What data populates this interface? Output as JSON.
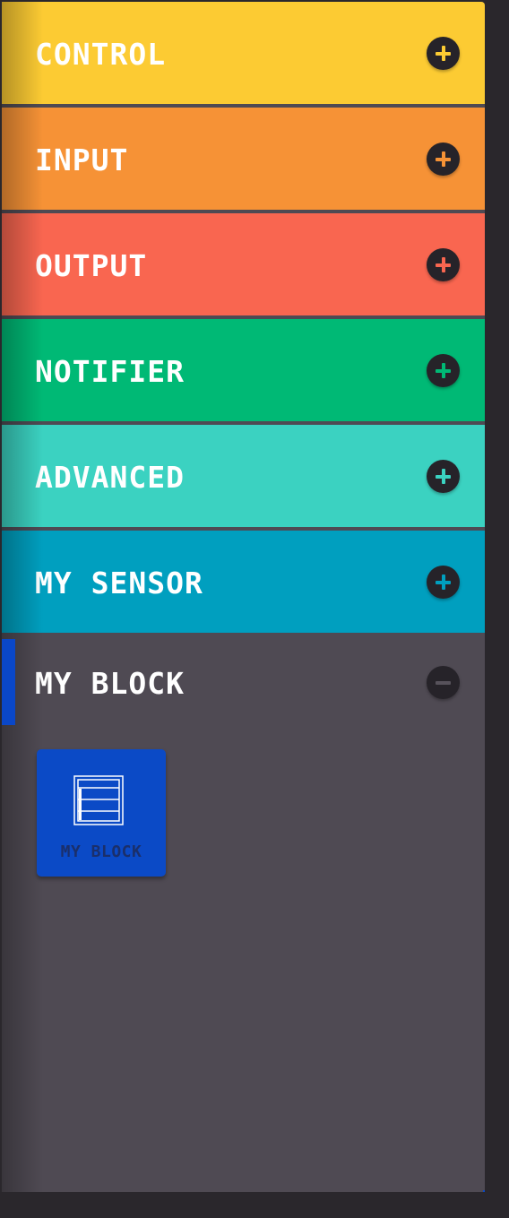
{
  "categories": [
    {
      "label": "CONTROL",
      "color": "#fccb33",
      "toggle": "plus"
    },
    {
      "label": "INPUT",
      "color": "#f69236",
      "toggle": "plus"
    },
    {
      "label": "OUTPUT",
      "color": "#f96650",
      "toggle": "plus"
    },
    {
      "label": "NOTIFIER",
      "color": "#00b975",
      "toggle": "plus"
    },
    {
      "label": "ADVANCED",
      "color": "#3bd2c1",
      "toggle": "plus"
    },
    {
      "label": "MY SENSOR",
      "color": "#009fbf",
      "toggle": "plus"
    },
    {
      "label": "MY BLOCK",
      "color": "#4f4a53",
      "toggle": "minus"
    }
  ],
  "blocks": [
    {
      "label": "MY BLOCK",
      "icon": "document-icon",
      "color": "#0b4ac6"
    }
  ],
  "colors": {
    "selection_marker": "#0a47c8",
    "panel_background": "#4f4a53",
    "toggle_background": "#262329"
  }
}
